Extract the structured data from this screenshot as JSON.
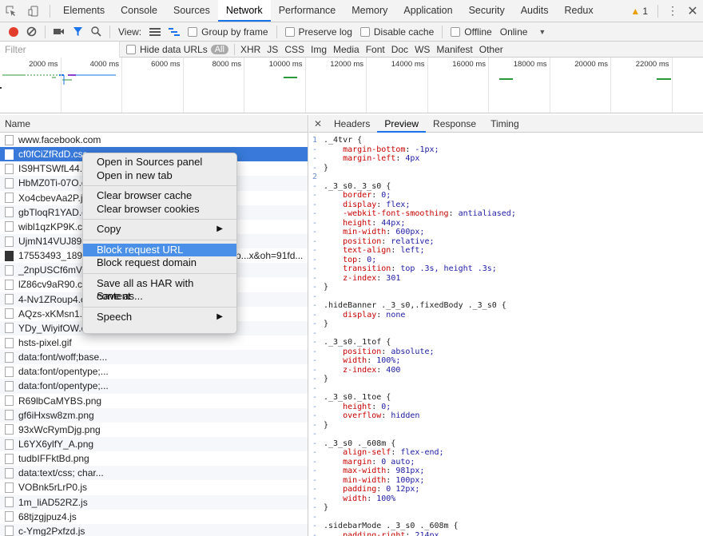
{
  "tabbar": {
    "tabs": [
      "Elements",
      "Console",
      "Sources",
      "Network",
      "Performance",
      "Memory",
      "Application",
      "Security",
      "Audits",
      "Redux"
    ],
    "active": "Network",
    "warning_count": "1"
  },
  "toolbar": {
    "view_label": "View:",
    "group_label": "Group by frame",
    "preserve_label": "Preserve log",
    "disable_cache_label": "Disable cache",
    "offline_label": "Offline",
    "online_label": "Online"
  },
  "filterbar": {
    "placeholder": "Filter",
    "hide_data_urls": "Hide data URLs",
    "all": "All",
    "types": [
      "XHR",
      "JS",
      "CSS",
      "Img",
      "Media",
      "Font",
      "Doc",
      "WS",
      "Manifest",
      "Other"
    ]
  },
  "overview": {
    "ticks": [
      "2000 ms",
      "4000 ms",
      "6000 ms",
      "8000 ms",
      "10000 ms",
      "12000 ms",
      "14000 ms",
      "16000 ms",
      "18000 ms",
      "20000 ms",
      "22000 ms"
    ]
  },
  "left": {
    "header": "Name",
    "rows": [
      {
        "name": "www.facebook.com"
      },
      {
        "name": "cf0fCiZfRdD.css"
      },
      {
        "name": "IS9HTSWfL44.cs"
      },
      {
        "name": "HbMZ0Ti-07O.cs"
      },
      {
        "name": "Xo4cbevAa2P.js"
      },
      {
        "name": "gbTloqR1YAD.cs"
      },
      {
        "name": "wibl1qzKP9K.css"
      },
      {
        "name": "UjmN14VUJ89.c"
      },
      {
        "name": "17553493_18932",
        "extra": "p...x&oh=91fd..."
      },
      {
        "name": "_2npUSCf6mV.gi"
      },
      {
        "name": "lZ86cv9aR90.css"
      },
      {
        "name": "4-Nv1ZRoup4.cs"
      },
      {
        "name": "AQzs-xKMsn1.cs"
      },
      {
        "name": "YDy_WiyifOW.cs"
      },
      {
        "name": "hsts-pixel.gif"
      },
      {
        "name": "data:font/woff;base..."
      },
      {
        "name": "data:font/opentype;..."
      },
      {
        "name": "data:font/opentype;..."
      },
      {
        "name": "R69lbCaMYBS.png"
      },
      {
        "name": "gf6iHxsw8zm.png"
      },
      {
        "name": "93xWcRymDjg.png"
      },
      {
        "name": "L6YX6ylfY_A.png"
      },
      {
        "name": "tudbIFFktBd.png"
      },
      {
        "name": "data:text/css; char..."
      },
      {
        "name": "VOBnk5rLrP0.js"
      },
      {
        "name": "1m_liAD52RZ.js"
      },
      {
        "name": "68tjzgjpuz4.js"
      },
      {
        "name": "c-Ymg2Pxfzd.js"
      }
    ]
  },
  "right": {
    "tabs": [
      "Headers",
      "Preview",
      "Response",
      "Timing"
    ],
    "active": "Preview",
    "code": [
      {
        "g": "1",
        "t": "._4tvr {"
      },
      {
        "g": "-",
        "t": "    margin-bottom: -1px;"
      },
      {
        "g": "-",
        "t": "    margin-left: 4px"
      },
      {
        "g": "-",
        "t": "}"
      },
      {
        "g": "2",
        "t": ""
      },
      {
        "g": "-",
        "t": "._3_s0._3_s0 {"
      },
      {
        "g": "-",
        "t": "    border: 0;"
      },
      {
        "g": "-",
        "t": "    display: flex;"
      },
      {
        "g": "-",
        "t": "    -webkit-font-smoothing: antialiased;"
      },
      {
        "g": "-",
        "t": "    height: 44px;"
      },
      {
        "g": "-",
        "t": "    min-width: 600px;"
      },
      {
        "g": "-",
        "t": "    position: relative;"
      },
      {
        "g": "-",
        "t": "    text-align: left;"
      },
      {
        "g": "-",
        "t": "    top: 0;"
      },
      {
        "g": "-",
        "t": "    transition: top .3s, height .3s;"
      },
      {
        "g": "-",
        "t": "    z-index: 301"
      },
      {
        "g": "-",
        "t": "}"
      },
      {
        "g": "-",
        "t": ""
      },
      {
        "g": "-",
        "t": ".hideBanner ._3_s0,.fixedBody ._3_s0 {"
      },
      {
        "g": "-",
        "t": "    display: none"
      },
      {
        "g": "-",
        "t": "}"
      },
      {
        "g": "-",
        "t": ""
      },
      {
        "g": "-",
        "t": "._3_s0._1tof {"
      },
      {
        "g": "-",
        "t": "    position: absolute;"
      },
      {
        "g": "-",
        "t": "    width: 100%;"
      },
      {
        "g": "-",
        "t": "    z-index: 400"
      },
      {
        "g": "-",
        "t": "}"
      },
      {
        "g": "-",
        "t": ""
      },
      {
        "g": "-",
        "t": "._3_s0._1toe {"
      },
      {
        "g": "-",
        "t": "    height: 0;"
      },
      {
        "g": "-",
        "t": "    overflow: hidden"
      },
      {
        "g": "-",
        "t": "}"
      },
      {
        "g": "-",
        "t": ""
      },
      {
        "g": "-",
        "t": "._3_s0 ._608m {"
      },
      {
        "g": "-",
        "t": "    align-self: flex-end;"
      },
      {
        "g": "-",
        "t": "    margin: 0 auto;"
      },
      {
        "g": "-",
        "t": "    max-width: 981px;"
      },
      {
        "g": "-",
        "t": "    min-width: 100px;"
      },
      {
        "g": "-",
        "t": "    padding: 0 12px;"
      },
      {
        "g": "-",
        "t": "    width: 100%"
      },
      {
        "g": "-",
        "t": "}"
      },
      {
        "g": "-",
        "t": ""
      },
      {
        "g": "-",
        "t": ".sidebarMode ._3_s0 ._608m {"
      },
      {
        "g": "-",
        "t": "    padding-right: 214px"
      }
    ]
  },
  "menu": {
    "items": [
      {
        "label": "Open in Sources panel"
      },
      {
        "label": "Open in new tab"
      },
      {
        "sep": true
      },
      {
        "label": "Clear browser cache"
      },
      {
        "label": "Clear browser cookies"
      },
      {
        "sep": true
      },
      {
        "label": "Copy",
        "arrow": true
      },
      {
        "sep": true
      },
      {
        "label": "Block request URL",
        "highlight": true
      },
      {
        "label": "Block request domain"
      },
      {
        "sep": true
      },
      {
        "label": "Save all as HAR with content"
      },
      {
        "label": "Save as..."
      },
      {
        "sep": true
      },
      {
        "label": "Speech",
        "arrow": true
      }
    ]
  }
}
